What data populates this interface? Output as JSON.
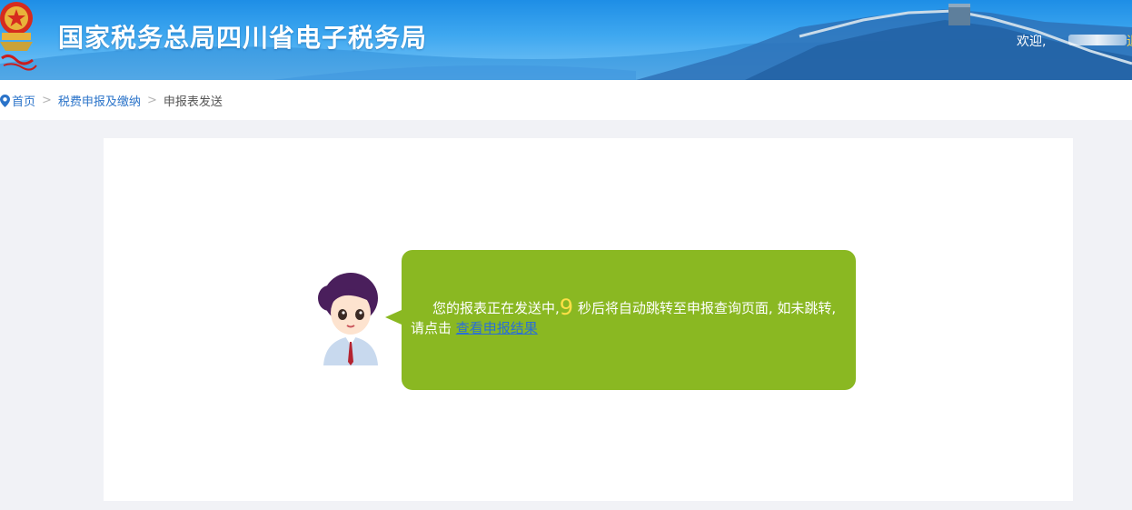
{
  "header": {
    "site_title": "国家税务总局四川省电子税务局",
    "welcome_label": "欢迎,",
    "truncated_char": "退"
  },
  "breadcrumb": {
    "items": [
      "首页",
      "税费申报及缴纳",
      "申报表发送"
    ],
    "separator": ">"
  },
  "message": {
    "text_before": "您的报表正在发送中,",
    "countdown_seconds": "9",
    "text_after": " 秒后将自动跳转至申报查询页面, 如未跳转, 请点击 ",
    "link_label": "查看申报结果"
  },
  "colors": {
    "header_blue": "#1e8ee6",
    "bubble_green": "#8ab822",
    "countdown_yellow": "#ffe046",
    "link_blue": "#2a6fd6",
    "page_bg": "#f1f2f6"
  }
}
